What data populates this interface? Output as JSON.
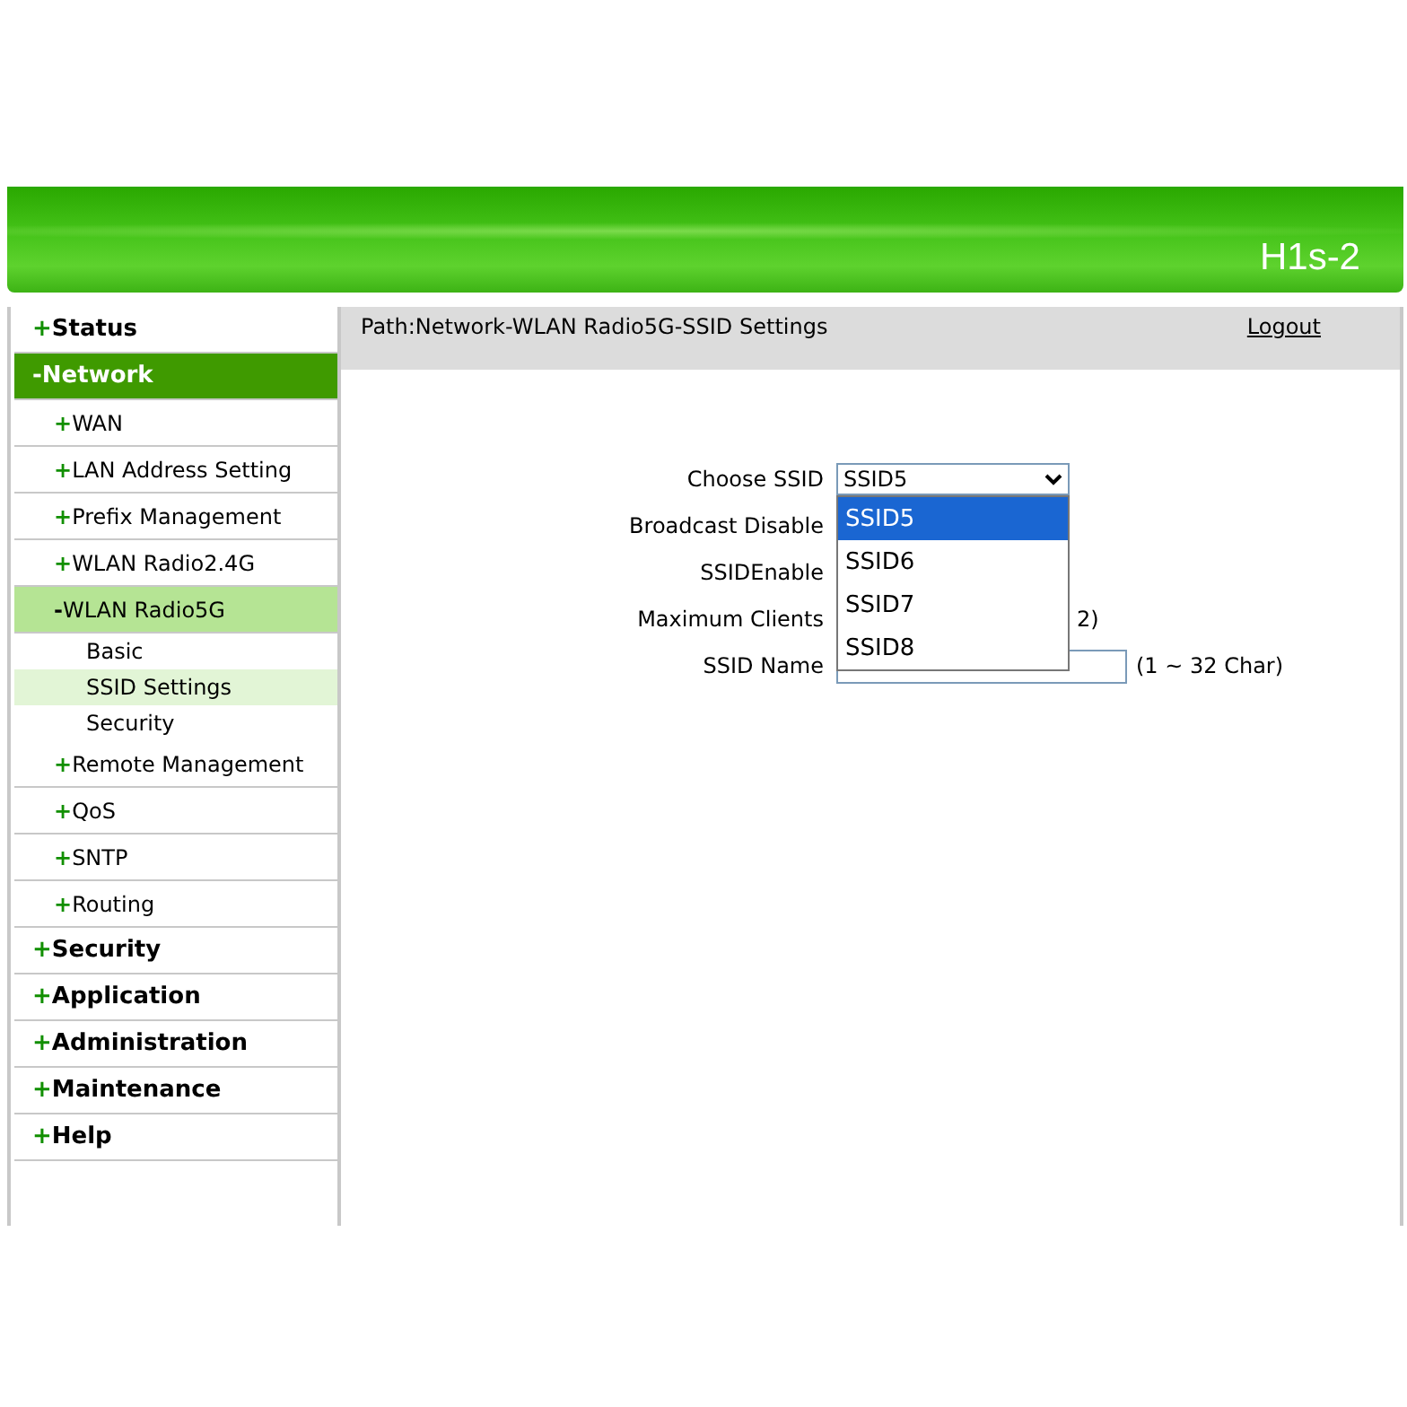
{
  "banner": {
    "title": "H1s-2"
  },
  "nav": [
    {
      "sign": "+",
      "label": "Status",
      "selected": false
    },
    {
      "sign": "-",
      "label": "Network",
      "selected": true,
      "children": [
        {
          "sign": "+",
          "label": "WAN",
          "selected": false
        },
        {
          "sign": "+",
          "label": "LAN Address Setting",
          "selected": false
        },
        {
          "sign": "+",
          "label": "Prefix Management",
          "selected": false
        },
        {
          "sign": "+",
          "label": "WLAN Radio2.4G",
          "selected": false
        },
        {
          "sign": "-",
          "label": "WLAN Radio5G",
          "selected": true,
          "children": [
            {
              "label": "Basic",
              "selected": false
            },
            {
              "label": "SSID Settings",
              "selected": true
            },
            {
              "label": "Security",
              "selected": false
            }
          ]
        },
        {
          "sign": "+",
          "label": "Remote Management",
          "selected": false
        },
        {
          "sign": "+",
          "label": "QoS",
          "selected": false
        },
        {
          "sign": "+",
          "label": "SNTP",
          "selected": false
        },
        {
          "sign": "+",
          "label": "Routing",
          "selected": false
        }
      ]
    },
    {
      "sign": "+",
      "label": "Security",
      "selected": false
    },
    {
      "sign": "+",
      "label": "Application",
      "selected": false
    },
    {
      "sign": "+",
      "label": "Administration",
      "selected": false
    },
    {
      "sign": "+",
      "label": "Maintenance",
      "selected": false
    },
    {
      "sign": "+",
      "label": "Help",
      "selected": false
    }
  ],
  "path": "Path:Network-WLAN Radio5G-SSID Settings",
  "logout": "Logout",
  "form": [
    {
      "kind": "select",
      "label": "Choose SSID",
      "value": "SSID5",
      "options": [
        {
          "label": "SSID5",
          "selected": true
        },
        {
          "label": "SSID6",
          "selected": false
        },
        {
          "label": "SSID7",
          "selected": false
        },
        {
          "label": "SSID8",
          "selected": false
        }
      ]
    },
    {
      "kind": "hidden",
      "label": "Broadcast Disable"
    },
    {
      "kind": "hidden",
      "label": "SSIDEnable"
    },
    {
      "kind": "hidden",
      "label": "Maximum Clients",
      "hint": "2)"
    },
    {
      "kind": "text",
      "label": "SSID Name",
      "hint": "(1 ~ 32 Char)"
    }
  ]
}
